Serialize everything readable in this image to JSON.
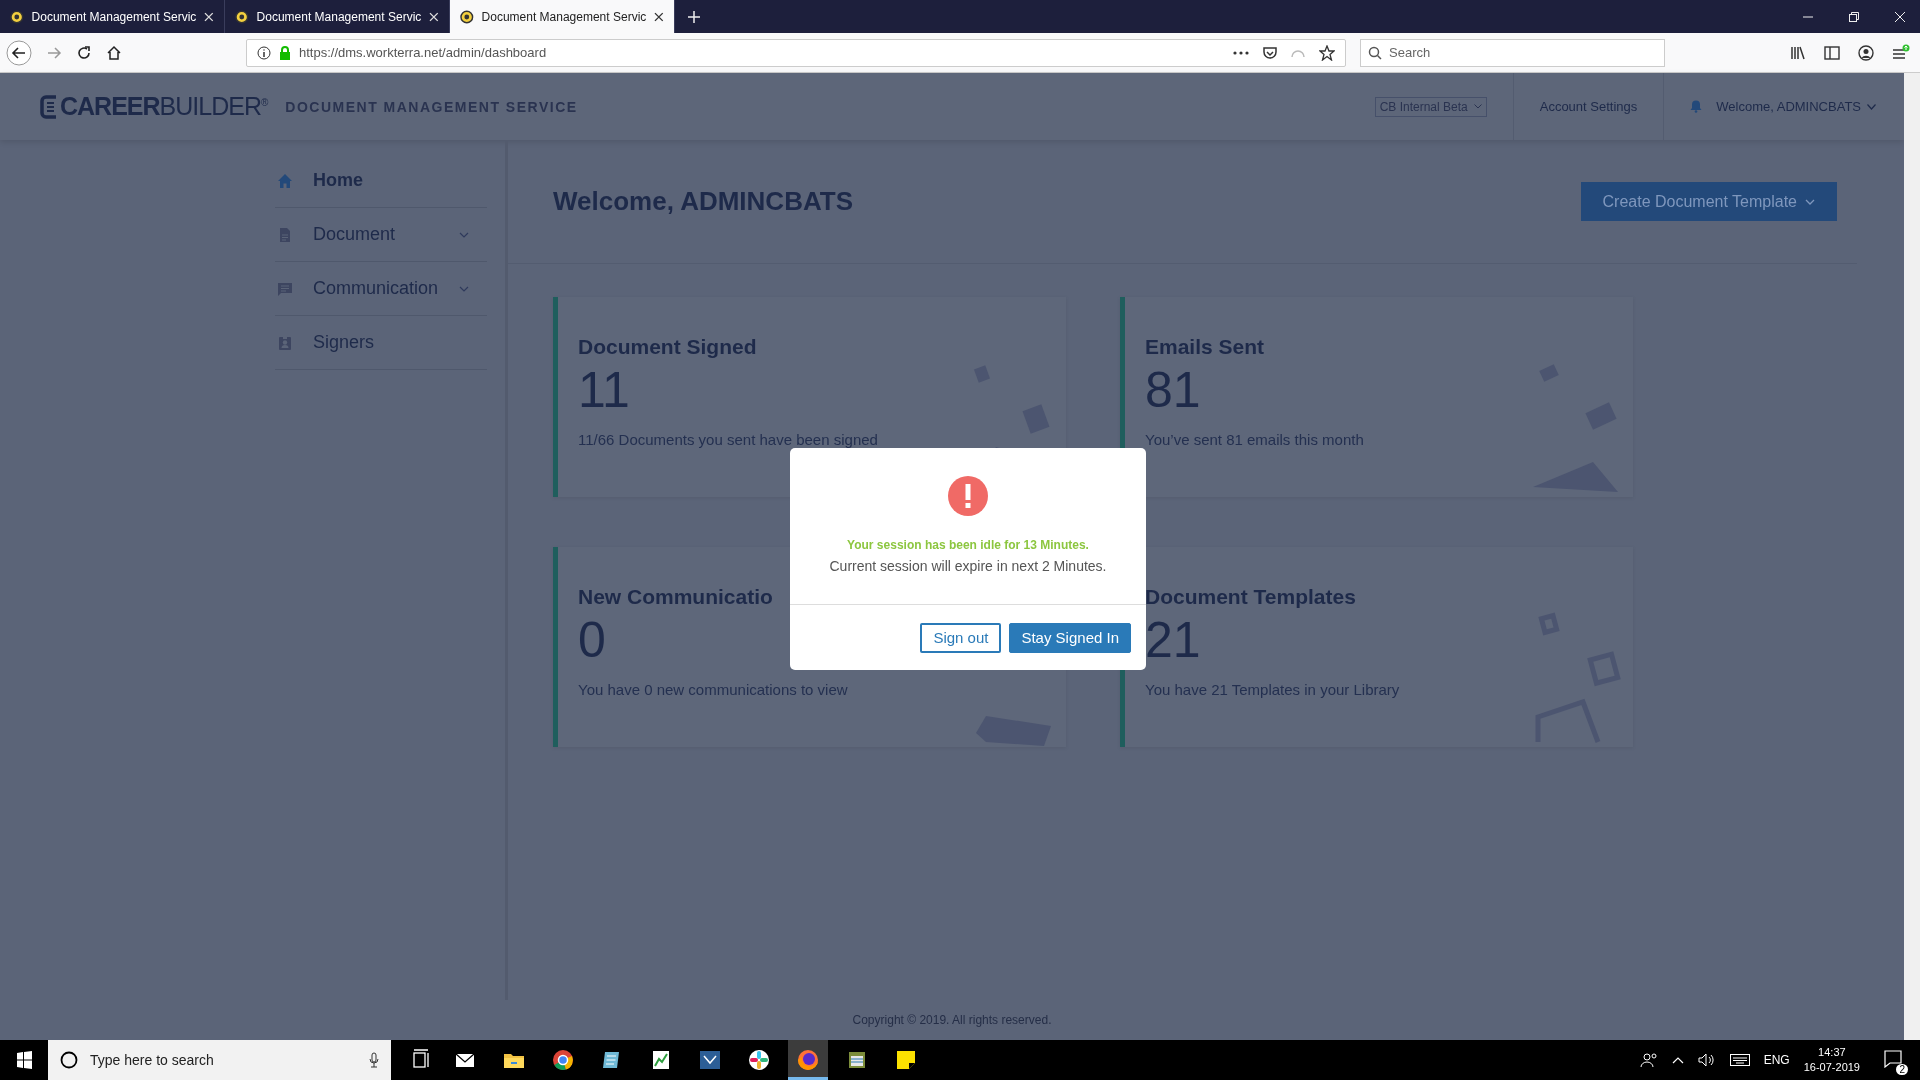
{
  "browser": {
    "tabs": [
      {
        "title": "Document Management Servic",
        "selected": false
      },
      {
        "title": "Document Management Servic",
        "selected": false
      },
      {
        "title": "Document Management Servic",
        "selected": true
      }
    ],
    "url": "https://dms.workterra.net/admin/dashboard",
    "search": {
      "placeholder": "Search"
    }
  },
  "header": {
    "logo": "**CAREER**BUILDER$^{®}$",
    "app_title": "DOCUMENT MANAGEMENT SERVICE",
    "environment": "CB Internal Beta",
    "account_settings": "Account Settings",
    "user_menu": "Welcome, ADMINCBATS"
  },
  "sidebar": {
    "items": [
      {
        "label": "Home",
        "kind": "home",
        "expandable": false,
        "selected": true
      },
      {
        "label": "Document",
        "kind": "document",
        "expandable": true,
        "selected": false
      },
      {
        "label": "Communication",
        "kind": "chat",
        "expandable": true,
        "selected": false
      },
      {
        "label": "Signers",
        "kind": "badge",
        "expandable": false,
        "selected": false
      }
    ]
  },
  "main": {
    "title": "Welcome, ADMINCBATS",
    "create_button": "Create Document Template",
    "cards": [
      {
        "kind": "document",
        "title": "Document Signed",
        "count": "11",
        "text": "11/66 Documents you sent have been signed"
      },
      {
        "kind": "email",
        "title": "Emails Sent",
        "count": "81",
        "text": "You’ve sent 81 emails this month"
      },
      {
        "kind": "communication",
        "title": "New Communicatio",
        "count": "0",
        "text": "You have 0 new communications to view"
      },
      {
        "kind": "template",
        "title": "Document Templates",
        "count": "21",
        "text": "You have 21 Templates in your Library"
      }
    ]
  },
  "footer": "Copyright © 2019. All rights reserved.",
  "modal": {
    "idle_message": "Your session has been idle for 13 Minutes.",
    "expiry_message": "Current session will expire in next 2 Minutes.",
    "buttons": [
      {
        "kind": "secondary",
        "label": "Sign out"
      },
      {
        "kind": "primary",
        "label": "Stay Signed In"
      }
    ]
  },
  "taskbar": {
    "search": {
      "placeholder": "Type here to search"
    },
    "apps": [
      {
        "kind": "mail",
        "selected": false
      },
      {
        "kind": "folder",
        "selected": false
      },
      {
        "kind": "chrome",
        "selected": false
      },
      {
        "kind": "notes",
        "selected": false
      },
      {
        "kind": "sheet",
        "selected": false
      },
      {
        "kind": "code",
        "selected": false
      },
      {
        "kind": "chat",
        "selected": false
      },
      {
        "kind": "firefox",
        "selected": true
      },
      {
        "kind": "archive",
        "selected": false
      },
      {
        "kind": "sticky",
        "selected": false
      }
    ],
    "language": "ENG",
    "time": "14:37",
    "date": "16-07-2019",
    "notifications": "2"
  }
}
